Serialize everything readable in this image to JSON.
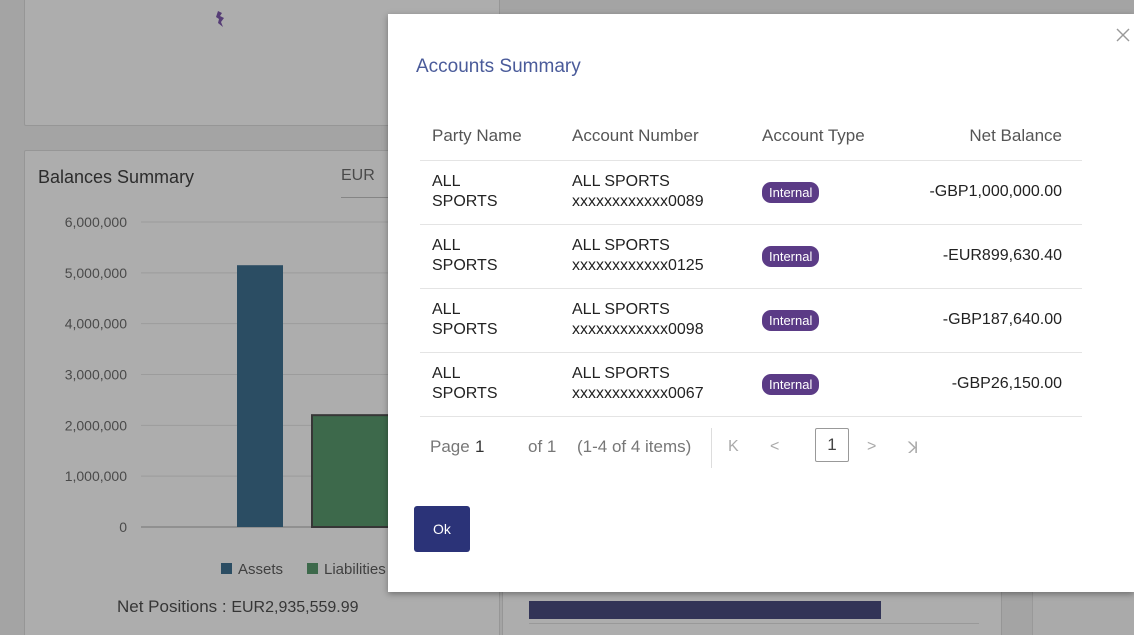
{
  "background": {
    "balances_title": "Balances Summary",
    "currency": "EUR",
    "net_positions_label": "Net Positions : ",
    "net_positions_value": "EUR2,935,559.99",
    "legend": [
      "Assets",
      "Liabilities"
    ]
  },
  "chart_data": {
    "type": "bar",
    "categories": [
      "Assets",
      "Liabilities"
    ],
    "values": [
      5150000,
      2200000
    ],
    "colors": [
      "#1f5a80",
      "#3e8a57"
    ],
    "ylim": [
      0,
      6000000
    ],
    "yticks": [
      0,
      1000000,
      2000000,
      3000000,
      4000000,
      5000000,
      6000000
    ],
    "ytick_labels": [
      "0",
      "1,000,000",
      "2,000,000",
      "3,000,000",
      "4,000,000",
      "5,000,000",
      "6,000,000"
    ],
    "legend_entries": [
      "Assets",
      "Liabilities"
    ],
    "grid": true
  },
  "modal": {
    "title": "Accounts Summary",
    "columns": [
      "Party Name",
      "Account Number",
      "Account Type",
      "Net Balance"
    ],
    "rows": [
      {
        "party_line1": "ALL",
        "party_line2": "SPORTS",
        "acct_line1": "ALL SPORTS",
        "acct_line2": "xxxxxxxxxxxx0089",
        "type": "Internal",
        "balance": "-GBP1,000,000.00"
      },
      {
        "party_line1": "ALL",
        "party_line2": "SPORTS",
        "acct_line1": "ALL SPORTS",
        "acct_line2": "xxxxxxxxxxxx0125",
        "type": "Internal",
        "balance": "-EUR899,630.40"
      },
      {
        "party_line1": "ALL",
        "party_line2": "SPORTS",
        "acct_line1": "ALL SPORTS",
        "acct_line2": "xxxxxxxxxxxx0098",
        "type": "Internal",
        "balance": "-GBP187,640.00"
      },
      {
        "party_line1": "ALL",
        "party_line2": "SPORTS",
        "acct_line1": "ALL SPORTS",
        "acct_line2": "xxxxxxxxxxxx0067",
        "type": "Internal",
        "balance": "-GBP26,150.00"
      }
    ],
    "pager": {
      "page_label": "Page",
      "page_number": "1",
      "of_label": "of 1",
      "range": "(1-4 of 4 items)",
      "current": "1",
      "first_glyph": "K",
      "prev_glyph": "<",
      "next_glyph": ">",
      "last_glyph": "ꓘ"
    },
    "ok_label": "Ok",
    "close_glyph": "×"
  },
  "colors": {
    "modal_title": "#4a5b9a",
    "badge": "#5b3b86",
    "ok_button": "#2b3378"
  }
}
